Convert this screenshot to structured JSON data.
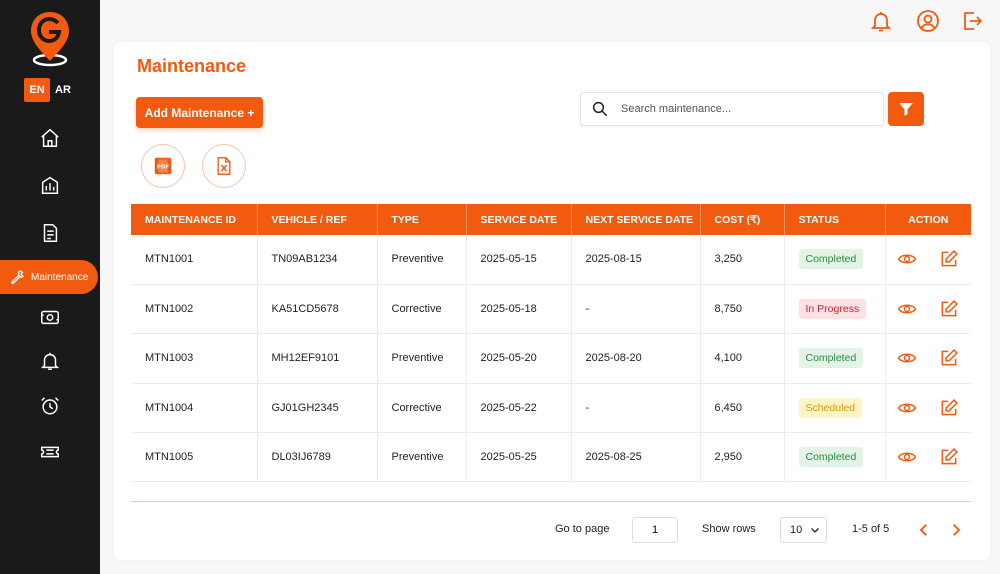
{
  "languages": [
    {
      "code": "EN",
      "active": true
    },
    {
      "code": "AR",
      "active": false
    }
  ],
  "sidebar": {
    "items": [
      {
        "icon": "home-icon"
      },
      {
        "icon": "reports-chart-icon"
      },
      {
        "icon": "document-icon"
      },
      {
        "icon": "wrench-icon",
        "label": "Maintenance",
        "active": true
      },
      {
        "icon": "cash-icon"
      },
      {
        "icon": "bell-icon"
      },
      {
        "icon": "alarm-clock-icon"
      },
      {
        "icon": "ticket-icon"
      }
    ]
  },
  "topbar": {
    "icons": [
      "bell-icon",
      "user-profile-icon",
      "logout-icon"
    ]
  },
  "page": {
    "title": "Maintenance",
    "add_label": "Add Maintenance +",
    "export_icons": [
      "pdf-icon",
      "excel-icon"
    ],
    "search_placeholder": "Search maintenance...",
    "filter_icon": "filter-icon"
  },
  "table": {
    "headers": [
      "MAINTENANCE ID",
      "VEHICLE / REF",
      "TYPE",
      "SERVICE DATE",
      "NEXT SERVICE DATE",
      "COST (₹)",
      "STATUS",
      "ACTION"
    ],
    "rows": [
      {
        "id": "MTN1001",
        "vehicle": "TN09AB1234",
        "type": "Preventive",
        "service_date": "2025-05-15",
        "next_date": "2025-08-15",
        "cost": "3,250",
        "status": "Completed"
      },
      {
        "id": "MTN1002",
        "vehicle": "KA51CD5678",
        "type": "Corrective",
        "service_date": "2025-05-18",
        "next_date": "-",
        "cost": "8,750",
        "status": "In Progress"
      },
      {
        "id": "MTN1003",
        "vehicle": "MH12EF9101",
        "type": "Preventive",
        "service_date": "2025-05-20",
        "next_date": "2025-08-20",
        "cost": "4,100",
        "status": "Completed"
      },
      {
        "id": "MTN1004",
        "vehicle": "GJ01GH2345",
        "type": "Corrective",
        "service_date": "2025-05-22",
        "next_date": "-",
        "cost": "6,450",
        "status": "Scheduled"
      },
      {
        "id": "MTN1005",
        "vehicle": "DL03IJ6789",
        "type": "Preventive",
        "service_date": "2025-05-25",
        "next_date": "2025-08-25",
        "cost": "2,950",
        "status": "Completed"
      }
    ]
  },
  "pagination": {
    "goto_label": "Go to page",
    "page": "1",
    "rows_label": "Show rows",
    "rows_value": "10",
    "range": "1-5 of 5"
  },
  "colors": {
    "accent": "#f15a0f",
    "sidebar": "#1a1a1a",
    "completed": "#2e8b3c",
    "in_progress": "#c62838",
    "scheduled": "#d79a00"
  }
}
